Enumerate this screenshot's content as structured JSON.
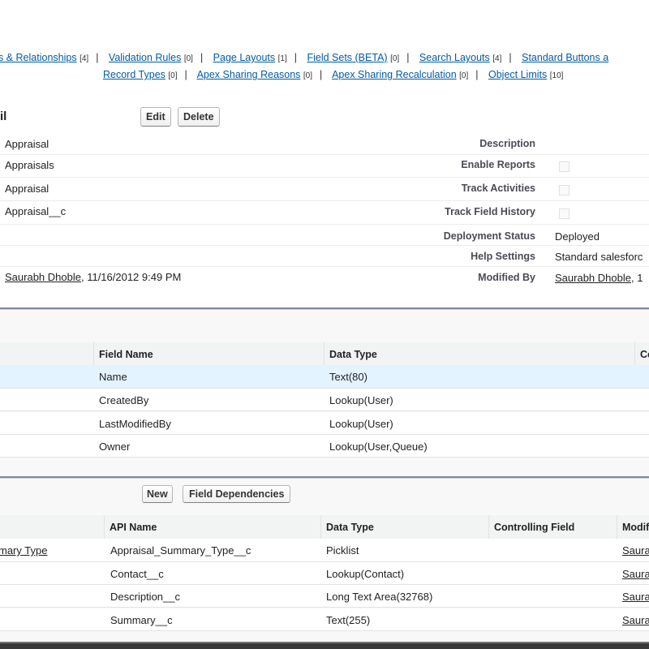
{
  "nav": {
    "row1": [
      {
        "label": "s & Relationships",
        "count": "[4]"
      },
      {
        "label": "Validation Rules",
        "count": "[0]"
      },
      {
        "label": "Page Layouts",
        "count": "[1]"
      },
      {
        "label": "Field Sets (BETA)",
        "count": "[0]"
      },
      {
        "label": "Search Layouts",
        "count": "[4]"
      },
      {
        "label": "Standard Buttons a",
        "count": ""
      }
    ],
    "row2": [
      {
        "label": "Record Types",
        "count": "[0]"
      },
      {
        "label": "Apex Sharing Reasons",
        "count": "[0]"
      },
      {
        "label": "Apex Sharing Recalculation",
        "count": "[0]"
      },
      {
        "label": "Object Limits",
        "count": "[10]"
      }
    ]
  },
  "detail": {
    "title": "il",
    "edit": "Edit",
    "delete": "Delete",
    "left_values": [
      "Appraisal",
      "Appraisals",
      "Appraisal",
      "Appraisal__c"
    ],
    "modified_left_user": "Saurabh Dhoble",
    "modified_left_date": ", 11/16/2012 9:49 PM",
    "right": [
      {
        "label": "Description",
        "value": ""
      },
      {
        "label": "Enable Reports",
        "value": ""
      },
      {
        "label": "Track Activities",
        "value": ""
      },
      {
        "label": "Track Field History",
        "value": ""
      },
      {
        "label": "Deployment Status",
        "value": "Deployed"
      },
      {
        "label": "Help Settings",
        "value": "Standard salesforc"
      },
      {
        "label": "Modified By",
        "value": "Saurabh Dhoble",
        "suffix": ", 1"
      }
    ]
  },
  "standard_fields": {
    "headers": [
      "",
      "Field Name",
      "Data Type",
      "Co"
    ],
    "rows": [
      [
        "Name",
        "Text(80)"
      ],
      [
        "CreatedBy",
        "Lookup(User)"
      ],
      [
        "LastModifiedBy",
        "Lookup(User)"
      ],
      [
        "Owner",
        "Lookup(User,Queue)"
      ]
    ]
  },
  "custom_fields": {
    "new": "New",
    "field_dependencies": "Field Dependencies",
    "headers": [
      "",
      "API Name",
      "Data Type",
      "Controlling Field",
      "Modif"
    ],
    "rows": [
      {
        "label": "mary Type",
        "api": "Appraisal_Summary_Type__c",
        "type": "Picklist",
        "mod": "Saura"
      },
      {
        "label": "",
        "api": "Contact__c",
        "type": "Lookup(Contact)",
        "mod": "Saura"
      },
      {
        "label": "",
        "api": "Description__c",
        "type": "Long Text Area(32768)",
        "mod": "Saura"
      },
      {
        "label": "",
        "api": "Summary__c",
        "type": "Text(255)",
        "mod": "Saura"
      }
    ]
  }
}
